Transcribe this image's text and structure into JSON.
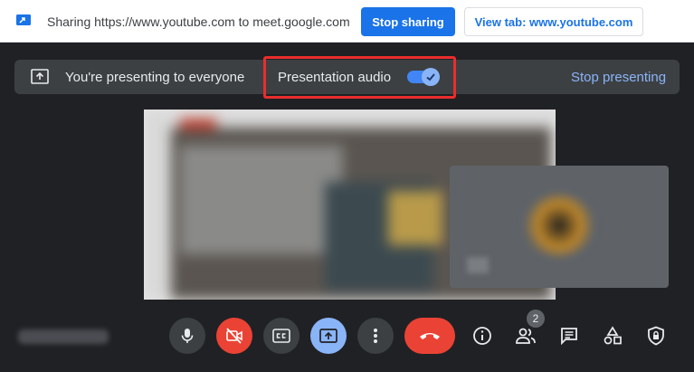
{
  "share_bar": {
    "message": "Sharing https://www.youtube.com to meet.google.com",
    "stop_sharing_label": "Stop sharing",
    "view_tab_label": "View tab: www.youtube.com"
  },
  "presenting_banner": {
    "message": "You're presenting to everyone",
    "audio_label": "Presentation audio",
    "audio_enabled": true,
    "stop_label": "Stop presenting"
  },
  "controls": {
    "participant_count": "2"
  },
  "colors": {
    "accent": "#1a73e8",
    "highlight_outline": "#ea2d2d",
    "end_call": "#ea4335",
    "present_active": "#8ab4f8"
  }
}
